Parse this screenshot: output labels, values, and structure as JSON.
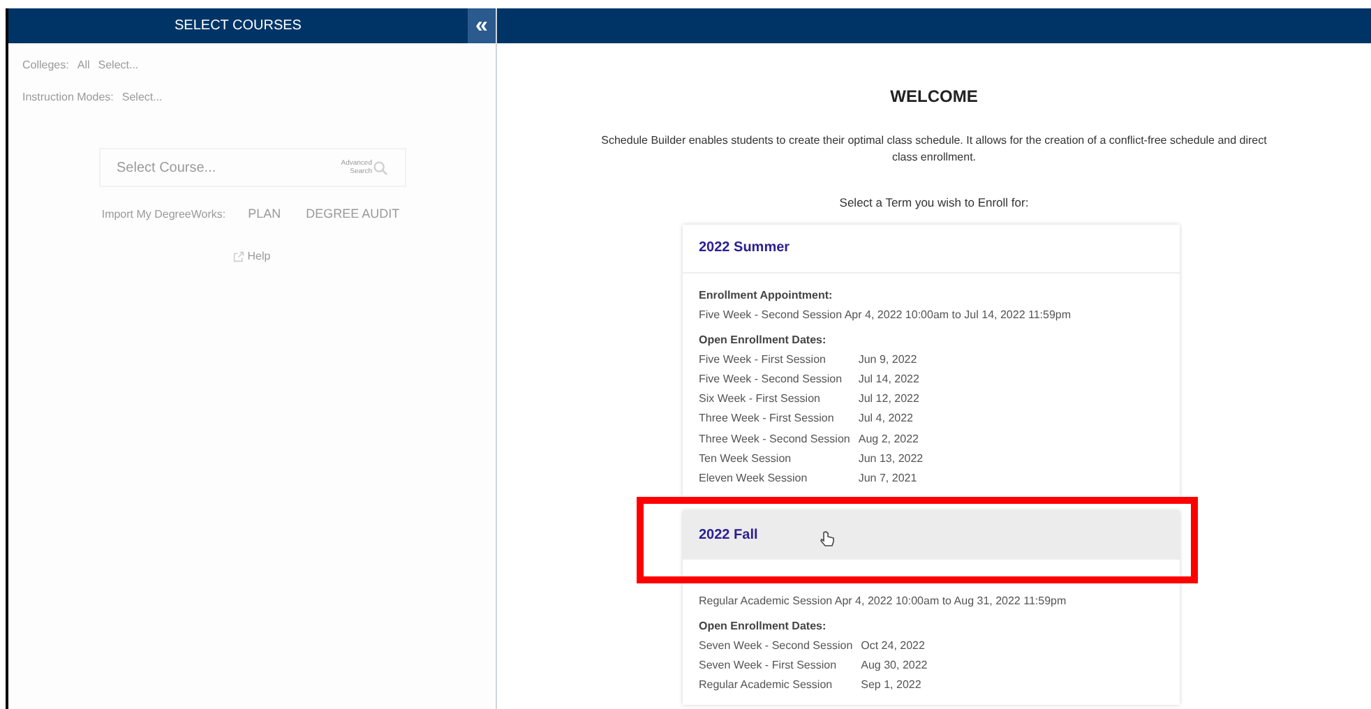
{
  "sidebar": {
    "title": "SELECT COURSES",
    "collapse_icon": "«",
    "filters": [
      {
        "label": "Colleges:",
        "value": "All",
        "placeholder": "Select..."
      },
      {
        "label": "Instruction Modes:",
        "placeholder": "Select..."
      }
    ],
    "course_search": {
      "placeholder": "Select Course...",
      "advanced_search": "Advanced Search"
    },
    "import_label": "Import My DegreeWorks:",
    "import_buttons": [
      "PLAN",
      "DEGREE AUDIT"
    ],
    "help": "Help",
    "disabled": true
  },
  "main": {
    "title": "WELCOME",
    "description": "Schedule Builder enables students to create their optimal class schedule. It allows for the creation of a conflict-free schedule and direct class enrollment.",
    "prompt": "Select a Term you wish to Enroll for:",
    "terms": [
      {
        "name": "2022 Summer",
        "hovered": false,
        "annotated": false,
        "appointment_label": "Enrollment Appointment:",
        "appointment": {
          "session": "Five Week - Second Session",
          "start": "Apr 4, 2022 10:00am",
          "to": "to",
          "end": "Jul 14, 2022 11:59pm"
        },
        "open_label": "Open Enrollment Dates:",
        "open_dates": [
          {
            "session": "Five Week - First Session",
            "date": "Jun 9, 2022"
          },
          {
            "session": "Five Week - Second Session",
            "date": "Jul 14, 2022"
          },
          {
            "session": "Six Week - First Session",
            "date": "Jul 12, 2022"
          },
          {
            "session": "Three Week - First Session",
            "date": "Jul 4, 2022"
          },
          {
            "session": "Three Week - Second Session",
            "date": "Aug 2, 2022"
          },
          {
            "session": "Ten Week Session",
            "date": "Jun 13, 2022"
          },
          {
            "session": "Eleven Week Session",
            "date": "Jun 7, 2021"
          }
        ]
      },
      {
        "name": "2022 Fall",
        "hovered": true,
        "annotated": true,
        "appointment": {
          "session": "Regular Academic Session",
          "start": "Apr 4, 2022 10:00am",
          "to": "to",
          "end": "Aug 31, 2022 11:59pm"
        },
        "open_label": "Open Enrollment Dates:",
        "open_dates": [
          {
            "session": "Seven Week - Second Session",
            "date": "Oct 24, 2022"
          },
          {
            "session": "Seven Week - First Session",
            "date": "Aug 30, 2022"
          },
          {
            "session": "Regular Academic Session",
            "date": "Sep 1, 2022"
          }
        ]
      }
    ]
  }
}
